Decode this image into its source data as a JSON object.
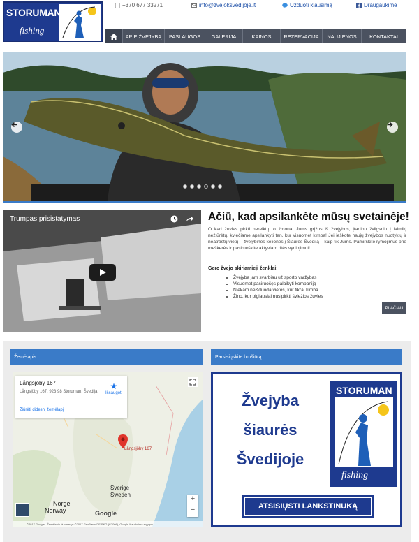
{
  "logo": {
    "line1": "STORUMAN",
    "line2": "fishing"
  },
  "topbar": {
    "phone": "+370 677 33271",
    "email": "info@zvejoksvedijoje.lt",
    "ask": "Užduoti klausimą",
    "facebook": "Draugaukime"
  },
  "nav": {
    "items": [
      "APIE ŽVEJYBĄ",
      "PASLAUGOS",
      "GALERIJA",
      "KAINOS",
      "REZERVACIJA",
      "NAUJIENOS",
      "KONTAKTAI"
    ]
  },
  "slider": {
    "dots": 6,
    "active_dot": 4
  },
  "video": {
    "title": "Trumpas prisistatymas"
  },
  "welcome": {
    "title": "Ačiū, kad apsilankėte mūsų svetainėje!",
    "text": "O kad žuvies pirkti nereiktų, o žmona, Jums grįžus iš žvejybos, įtartinu žvilgsniu į laimikį nežiūrėtų, kviečiame apsilankyti ten, kur visuomet kimba! Jei ieškote naujų žvejybos nuotykių ir neatrastų vietų – žvejybinės kelionės į Šiaurės Švediją – kaip tik Jums. Pamirškite rymojimus prie meškerės ir pasiruoškite aktyviam ritės vyniojimui!",
    "signs_title": "Gero žvejo skiriamieji ženklai:",
    "signs": [
      "Žvejyba jam svarbiau už sporto varžybas",
      "Visuomet pasiruošęs palaikyti kompaniją",
      "Niekam neišduoda vietos, kur tikrai kimba",
      "Žino, kur pigiausiai nusipirkti šviežios žuvies"
    ],
    "more": "PLAČIAU"
  },
  "map_panel": {
    "header": "Žemėlapis",
    "place": "Långsjöby 167",
    "address": "Långsjöby 167, 923 98 Storuman, Švedija",
    "save": "Išsaugoti",
    "bigger": "Žiūrėti didesnį žemėlapį",
    "marker_label": "Långsjöby 167",
    "countries": [
      "Norge",
      "Norway",
      "Sverige",
      "Sweden"
    ],
    "google": "Google",
    "footer": "©2017 Google - Žemėlapio duomenys ©2017 GeoBasis-DE/BKG (©2009), Google   Naudojimo sąlygos"
  },
  "flyer_panel": {
    "header": "Parsisiųskite brošiūrą",
    "lines": [
      "Žvejyba",
      "šiaurės",
      "Švedijoje"
    ],
    "download": "ATSISIŲSTI LANKSTINUKĄ",
    "logo_line1": "STORUMAN",
    "logo_line2": "fishing"
  },
  "colors": {
    "accent": "#3a7bc8",
    "brand": "#1e3a8f",
    "nav": "#4b5260"
  }
}
